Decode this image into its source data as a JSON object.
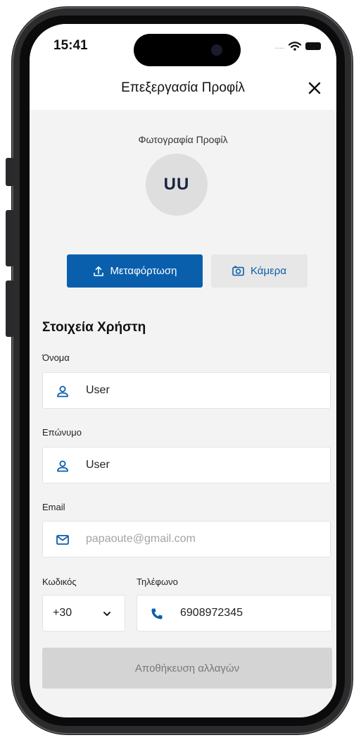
{
  "status_bar": {
    "time": "15:41",
    "signal": "...."
  },
  "header": {
    "title": "Επεξεργασία Προφίλ"
  },
  "profile_photo": {
    "label": "Φωτογραφία Προφίλ",
    "initials": "UU",
    "upload_label": "Μεταφόρτωση",
    "camera_label": "Κάμερα"
  },
  "user_details": {
    "section_title": "Στοιχεία Χρήστη",
    "first_name": {
      "label": "Όνομα",
      "value": "User"
    },
    "last_name": {
      "label": "Επώνυμο",
      "value": "User"
    },
    "email": {
      "label": "Email",
      "placeholder": "papaoute@gmail.com"
    },
    "country_code": {
      "label": "Κωδικός",
      "value": "+30"
    },
    "phone": {
      "label": "Τηλέφωνο",
      "value": "6908972345"
    }
  },
  "save_button": {
    "label": "Αποθήκευση αλλαγών"
  },
  "colors": {
    "accent": "#0a5fad",
    "background": "#f3f3f3",
    "disabled_button": "#d4d4d4"
  }
}
